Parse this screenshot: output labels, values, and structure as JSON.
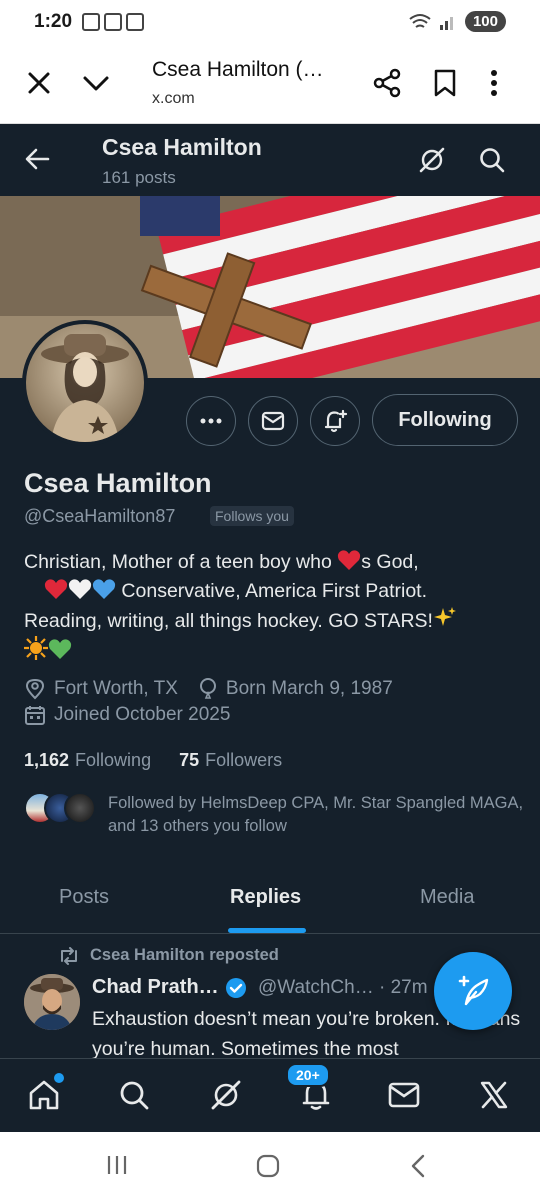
{
  "status_bar": {
    "time": "1:20",
    "battery": "100"
  },
  "browser": {
    "page_title": "Csea Hamilton (…",
    "url": "x.com"
  },
  "header": {
    "name": "Csea Hamilton",
    "post_count": "161 posts"
  },
  "profile": {
    "display_name": "Csea Hamilton",
    "handle": "@CseaHamilton87",
    "follows_you": "Follows you",
    "following_button": "Following",
    "bio_line1_a": "Christian, Mother of a teen boy who ",
    "bio_line1_b": "s God,",
    "bio_line2": " Conservative, America First Patriot.",
    "bio_line3": "Reading, writing, all things hockey. GO STARS!",
    "location": "Fort Worth, TX",
    "birthday": "Born March 9, 1987",
    "joined": "Joined October 2025",
    "following_count": "1,162",
    "following_label": "Following",
    "followers_count": "75",
    "followers_label": "Followers",
    "followed_by": "Followed by HelmsDeep CPA, Mr. Star Spangled MAGA, and 13 others you follow"
  },
  "tabs": [
    {
      "label": "Posts"
    },
    {
      "label": "Replies"
    },
    {
      "label": "Media"
    }
  ],
  "active_tab": "Replies",
  "tweet": {
    "repost_label": "Csea Hamilton reposted",
    "author_name": "Chad Prath…",
    "author_handle": "@WatchCh…",
    "time": "· 27m",
    "text": "Exhaustion doesn’t mean you’re broken. It means you’re human. Sometimes the most"
  },
  "bottom_nav": {
    "notifications_badge": "20+"
  },
  "colors": {
    "background": "#15202b",
    "accent": "#1d9bf0",
    "muted": "#8b98a5",
    "text": "#e7e9ea"
  },
  "icons": [
    "close-icon",
    "chevron-down-icon",
    "share-icon",
    "bookmark-icon",
    "more-vert-icon",
    "back-arrow-icon",
    "grok-icon",
    "search-icon",
    "more-icon",
    "mail-icon",
    "bell-plus-icon",
    "location-icon",
    "balloon-icon",
    "calendar-icon",
    "repost-icon",
    "verified-icon",
    "compose-icon",
    "home-icon",
    "notifications-icon",
    "x-logo-icon"
  ]
}
